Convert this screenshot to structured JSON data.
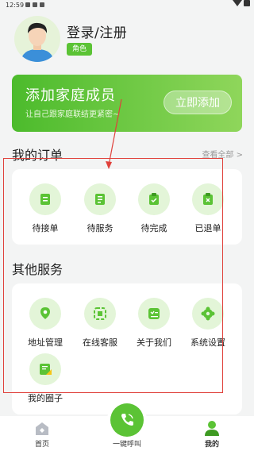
{
  "status_bar": {
    "time": "12:59"
  },
  "profile": {
    "login_text": "登录/注册",
    "role_badge": "角色"
  },
  "banner": {
    "title": "添加家庭成员",
    "subtitle": "让自己跟家庭联结更紧密~",
    "button": "立即添加"
  },
  "orders": {
    "title": "我的订单",
    "view_all": "查看全部 >",
    "items": [
      {
        "label": "待接单",
        "icon": "pending-order-icon"
      },
      {
        "label": "待服务",
        "icon": "pending-service-icon"
      },
      {
        "label": "待完成",
        "icon": "pending-complete-icon"
      },
      {
        "label": "已退单",
        "icon": "cancelled-order-icon"
      }
    ]
  },
  "services": {
    "title": "其他服务",
    "items": [
      {
        "label": "地址管理",
        "icon": "location-pin-icon"
      },
      {
        "label": "在线客服",
        "icon": "customer-service-icon"
      },
      {
        "label": "关于我们",
        "icon": "about-us-icon"
      },
      {
        "label": "系统设置",
        "icon": "settings-gear-icon"
      },
      {
        "label": "我的圈子",
        "icon": "my-circle-icon"
      }
    ]
  },
  "tabbar": {
    "home": "首页",
    "call": "一键呼叫",
    "mine": "我的"
  },
  "colors": {
    "accent": "#5bc335",
    "annotation_red": "#e0413b"
  }
}
